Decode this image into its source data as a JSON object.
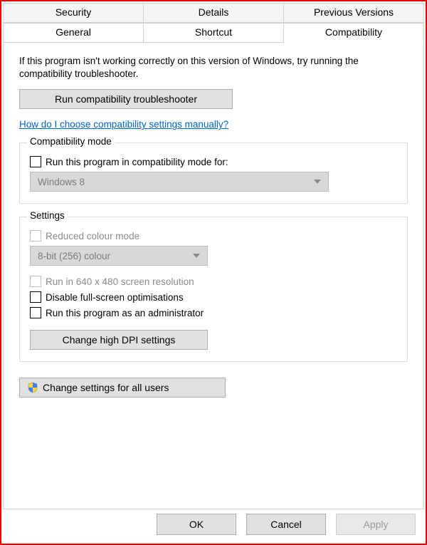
{
  "tabs": {
    "row1": [
      "Security",
      "Details",
      "Previous Versions"
    ],
    "row2": [
      "General",
      "Shortcut",
      "Compatibility"
    ],
    "active": "Compatibility"
  },
  "intro": "If this program isn't working correctly on this version of Windows, try running the compatibility troubleshooter.",
  "buttons": {
    "troubleshooter": "Run compatibility troubleshooter",
    "dpi": "Change high DPI settings",
    "all_users": "Change settings for all users",
    "ok": "OK",
    "cancel": "Cancel",
    "apply": "Apply"
  },
  "link_manual": "How do I choose compatibility settings manually?",
  "group_compat": {
    "legend": "Compatibility mode",
    "check_label": "Run this program in compatibility mode for:",
    "combo_value": "Windows 8"
  },
  "group_settings": {
    "legend": "Settings",
    "reduced_colour": "Reduced colour mode",
    "colour_combo": "8-bit (256) colour",
    "low_res": "Run in 640 x 480 screen resolution",
    "disable_fullscreen": "Disable full-screen optimisations",
    "run_admin": "Run this program as an administrator"
  }
}
